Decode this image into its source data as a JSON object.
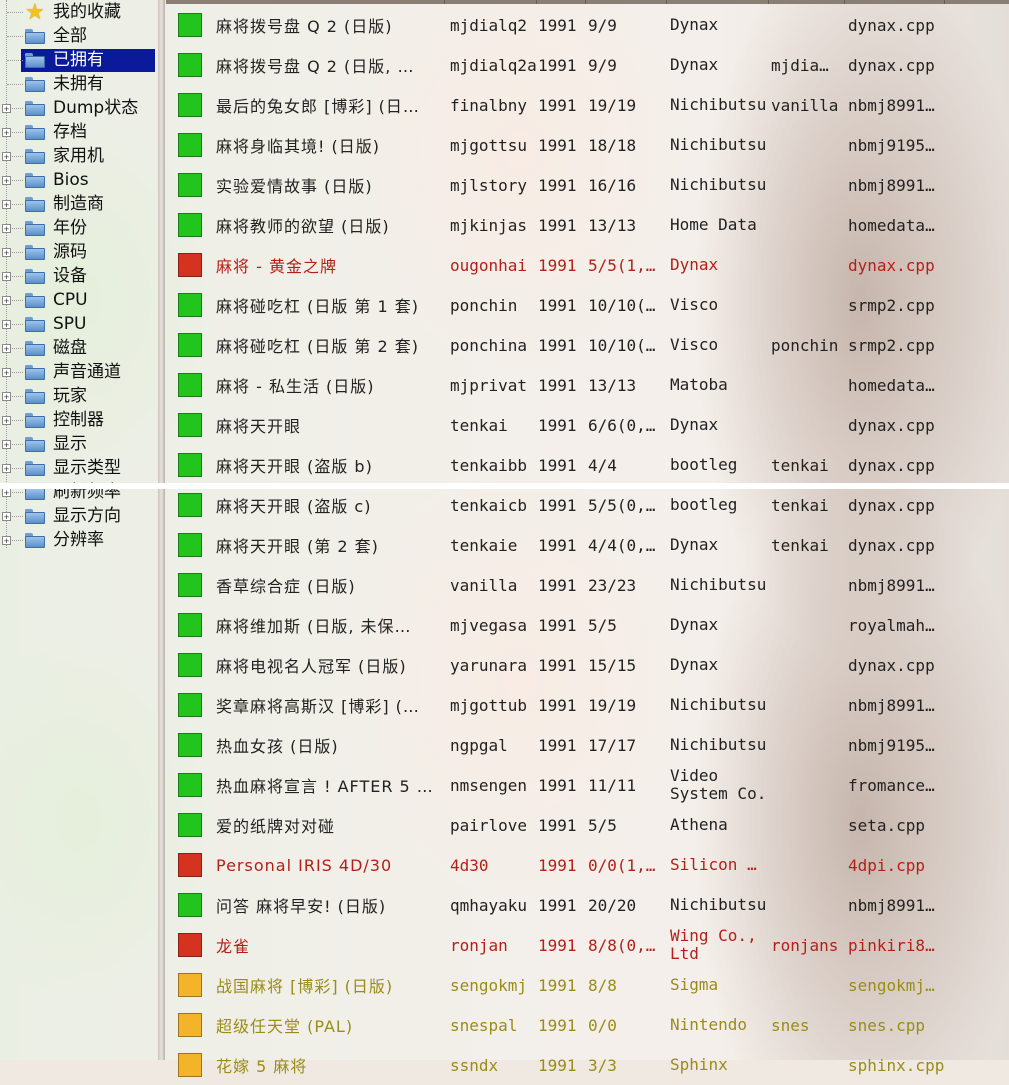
{
  "tree": {
    "items": [
      {
        "label": "我的收藏",
        "icon": "star-icon",
        "expandable": false,
        "selected": false
      },
      {
        "label": "全部",
        "icon": "folder-icon",
        "expandable": false,
        "selected": false
      },
      {
        "label": "已拥有",
        "icon": "folder-icon",
        "expandable": false,
        "selected": true
      },
      {
        "label": "未拥有",
        "icon": "folder-icon",
        "expandable": false,
        "selected": false
      },
      {
        "label": "Dump状态",
        "icon": "folder-icon",
        "expandable": true,
        "selected": false
      },
      {
        "label": "存档",
        "icon": "folder-icon",
        "expandable": true,
        "selected": false
      },
      {
        "label": "家用机",
        "icon": "folder-icon",
        "expandable": true,
        "selected": false
      },
      {
        "label": "Bios",
        "icon": "folder-icon",
        "expandable": true,
        "selected": false
      },
      {
        "label": "制造商",
        "icon": "folder-icon",
        "expandable": true,
        "selected": false
      },
      {
        "label": "年份",
        "icon": "folder-icon",
        "expandable": true,
        "selected": false
      },
      {
        "label": "源码",
        "icon": "folder-icon",
        "expandable": true,
        "selected": false
      },
      {
        "label": "设备",
        "icon": "folder-icon",
        "expandable": true,
        "selected": false
      },
      {
        "label": "CPU",
        "icon": "folder-icon",
        "expandable": true,
        "selected": false
      },
      {
        "label": "SPU",
        "icon": "folder-icon",
        "expandable": true,
        "selected": false
      },
      {
        "label": "磁盘",
        "icon": "folder-icon",
        "expandable": true,
        "selected": false
      },
      {
        "label": "声音通道",
        "icon": "folder-icon",
        "expandable": true,
        "selected": false
      },
      {
        "label": "玩家",
        "icon": "folder-icon",
        "expandable": true,
        "selected": false
      },
      {
        "label": "控制器",
        "icon": "folder-icon",
        "expandable": true,
        "selected": false
      },
      {
        "label": "显示",
        "icon": "folder-icon",
        "expandable": true,
        "selected": false
      },
      {
        "label": "显示类型",
        "icon": "folder-icon",
        "expandable": true,
        "selected": false
      },
      {
        "label": "刷新频率",
        "icon": "folder-icon",
        "expandable": true,
        "selected": false
      },
      {
        "label": "显示方向",
        "icon": "folder-icon",
        "expandable": true,
        "selected": false
      },
      {
        "label": "分辨率",
        "icon": "folder-icon",
        "expandable": true,
        "selected": false
      }
    ],
    "expander_glyph": "+"
  },
  "games": [
    {
      "status": "good",
      "description": "麻将拨号盘 Q 2 (日版)",
      "name": "mjdialq2",
      "year": "1991",
      "sets": "9/9",
      "manufacturer": "Dynax",
      "clone_of": "",
      "source": "dynax.cpp"
    },
    {
      "status": "good",
      "description": "麻将拨号盘 Q 2 (日版, …",
      "name": "mjdialq2a",
      "year": "1991",
      "sets": "9/9",
      "manufacturer": "Dynax",
      "clone_of": "mjdia…",
      "source": "dynax.cpp"
    },
    {
      "status": "good",
      "description": "最后的兔女郎 [博彩] (日…",
      "name": "finalbny",
      "year": "1991",
      "sets": "19/19",
      "manufacturer": "Nichibutsu",
      "clone_of": "vanilla",
      "source": "nbmj8991…"
    },
    {
      "status": "good",
      "description": "麻将身临其境! (日版)",
      "name": "mjgottsu",
      "year": "1991",
      "sets": "18/18",
      "manufacturer": "Nichibutsu",
      "clone_of": "",
      "source": "nbmj9195…"
    },
    {
      "status": "good",
      "description": "实验爱情故事 (日版)",
      "name": "mjlstory",
      "year": "1991",
      "sets": "16/16",
      "manufacturer": "Nichibutsu",
      "clone_of": "",
      "source": "nbmj8991…"
    },
    {
      "status": "good",
      "description": "麻将教师的欲望 (日版)",
      "name": "mjkinjas",
      "year": "1991",
      "sets": "13/13",
      "manufacturer": "Home Data",
      "clone_of": "",
      "source": "homedata…"
    },
    {
      "status": "bad",
      "description": "麻将 - 黄金之牌",
      "name": "ougonhai",
      "year": "1991",
      "sets": "5/5(1,…",
      "manufacturer": "Dynax",
      "clone_of": "",
      "source": "dynax.cpp"
    },
    {
      "status": "good",
      "description": "麻将碰吃杠 (日版 第 1 套)",
      "name": "ponchin",
      "year": "1991",
      "sets": "10/10(…",
      "manufacturer": "Visco",
      "clone_of": "",
      "source": "srmp2.cpp"
    },
    {
      "status": "good",
      "description": "麻将碰吃杠 (日版 第 2 套)",
      "name": "ponchina",
      "year": "1991",
      "sets": "10/10(…",
      "manufacturer": "Visco",
      "clone_of": "ponchin",
      "source": "srmp2.cpp"
    },
    {
      "status": "good",
      "description": "麻将 - 私生活 (日版)",
      "name": "mjprivat",
      "year": "1991",
      "sets": "13/13",
      "manufacturer": "Matoba",
      "clone_of": "",
      "source": "homedata…"
    },
    {
      "status": "good",
      "description": "麻将天开眼",
      "name": "tenkai",
      "year": "1991",
      "sets": "6/6(0,…",
      "manufacturer": "Dynax",
      "clone_of": "",
      "source": "dynax.cpp"
    },
    {
      "status": "good",
      "description": "麻将天开眼 (盗版 b)",
      "name": "tenkaibb",
      "year": "1991",
      "sets": "4/4",
      "manufacturer": "bootleg",
      "clone_of": "tenkai",
      "source": "dynax.cpp"
    },
    {
      "status": "good",
      "description": "麻将天开眼 (盗版 c)",
      "name": "tenkaicb",
      "year": "1991",
      "sets": "5/5(0,…",
      "manufacturer": "bootleg",
      "clone_of": "tenkai",
      "source": "dynax.cpp"
    },
    {
      "status": "good",
      "description": "麻将天开眼 (第 2 套)",
      "name": "tenkaie",
      "year": "1991",
      "sets": "4/4(0,…",
      "manufacturer": "Dynax",
      "clone_of": "tenkai",
      "source": "dynax.cpp"
    },
    {
      "status": "good",
      "description": "香草综合症 (日版)",
      "name": "vanilla",
      "year": "1991",
      "sets": "23/23",
      "manufacturer": "Nichibutsu",
      "clone_of": "",
      "source": "nbmj8991…"
    },
    {
      "status": "good",
      "description": "麻将维加斯 (日版, 未保…",
      "name": "mjvegasa",
      "year": "1991",
      "sets": "5/5",
      "manufacturer": "Dynax",
      "clone_of": "",
      "source": "royalmah…"
    },
    {
      "status": "good",
      "description": "麻将电视名人冠军 (日版)",
      "name": "yarunara",
      "year": "1991",
      "sets": "15/15",
      "manufacturer": "Dynax",
      "clone_of": "",
      "source": "dynax.cpp"
    },
    {
      "status": "good",
      "description": "奖章麻将高斯汉 [博彩] (…",
      "name": "mjgottub",
      "year": "1991",
      "sets": "19/19",
      "manufacturer": "Nichibutsu",
      "clone_of": "",
      "source": "nbmj8991…"
    },
    {
      "status": "good",
      "description": "热血女孩 (日版)",
      "name": "ngpgal",
      "year": "1991",
      "sets": "17/17",
      "manufacturer": "Nichibutsu",
      "clone_of": "",
      "source": "nbmj9195…"
    },
    {
      "status": "good",
      "description": "热血麻将宣言 ! AFTER 5 …",
      "name": "nmsengen",
      "year": "1991",
      "sets": "11/11",
      "manufacturer": "Video System Co.",
      "clone_of": "",
      "source": "fromance…"
    },
    {
      "status": "good",
      "description": "爱的纸牌对对碰",
      "name": "pairlove",
      "year": "1991",
      "sets": "5/5",
      "manufacturer": "Athena",
      "clone_of": "",
      "source": "seta.cpp"
    },
    {
      "status": "bad",
      "description": "Personal IRIS 4D/30",
      "name": "4d30",
      "year": "1991",
      "sets": "0/0(1,…",
      "manufacturer": "Silicon …",
      "clone_of": "",
      "source": "4dpi.cpp"
    },
    {
      "status": "good",
      "description": "问答 麻将早安! (日版)",
      "name": "qmhayaku",
      "year": "1991",
      "sets": "20/20",
      "manufacturer": "Nichibutsu",
      "clone_of": "",
      "source": "nbmj8991…"
    },
    {
      "status": "bad",
      "description": "龙雀",
      "name": "ronjan",
      "year": "1991",
      "sets": "8/8(0,…",
      "manufacturer": "Wing Co., Ltd",
      "clone_of": "ronjans",
      "source": "pinkiri8…"
    },
    {
      "status": "imperfect",
      "description": "战国麻将 [博彩] (日版)",
      "name": "sengokmj",
      "year": "1991",
      "sets": "8/8",
      "manufacturer": "Sigma",
      "clone_of": "",
      "source": "sengokmj…"
    },
    {
      "status": "imperfect",
      "description": "超级任天堂 (PAL)",
      "name": "snespal",
      "year": "1991",
      "sets": "0/0",
      "manufacturer": "Nintendo",
      "clone_of": "snes",
      "source": "snes.cpp"
    },
    {
      "status": "imperfect",
      "description": "花嫁 5 麻将",
      "name": "ssndx",
      "year": "1991",
      "sets": "3/3",
      "manufacturer": "Sphinx",
      "clone_of": "",
      "source": "sphinx.cpp"
    }
  ]
}
